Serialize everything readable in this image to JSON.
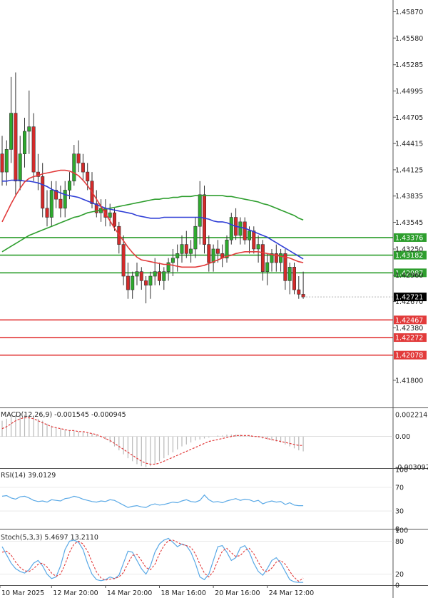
{
  "chart_data": [
    {
      "type": "candlestick",
      "panel": "price",
      "ylim": [
        1.415,
        1.46
      ],
      "yticks": [
        "1.45870",
        "1.45580",
        "1.45285",
        "1.44995",
        "1.44705",
        "1.44415",
        "1.44125",
        "1.43835",
        "1.43545",
        "1.43250",
        "1.42960",
        "1.42670",
        "1.42380",
        "1.41800"
      ],
      "xticks": [
        "10 Mar 2025",
        "12 Mar 20:00",
        "14 Mar 20:00",
        "18 Mar 16:00",
        "20 Mar 16:00",
        "24 Mar 12:00"
      ],
      "last_price": "1.42721",
      "support_resistance": [
        {
          "value": "1.43376",
          "color": "#2e9e2e"
        },
        {
          "value": "1.43182",
          "color": "#2e9e2e"
        },
        {
          "value": "1.42987",
          "color": "#2e9e2e"
        },
        {
          "value": "1.42467",
          "color": "#e23b3b"
        },
        {
          "value": "1.42272",
          "color": "#e23b3b"
        },
        {
          "value": "1.42078",
          "color": "#e23b3b"
        }
      ],
      "candles": [
        [
          1.443,
          1.445,
          1.4395,
          1.441
        ],
        [
          1.441,
          1.4445,
          1.4395,
          1.4435
        ],
        [
          1.4435,
          1.4515,
          1.442,
          1.4475
        ],
        [
          1.4475,
          1.452,
          1.4385,
          1.44
        ],
        [
          1.44,
          1.445,
          1.439,
          1.443
        ],
        [
          1.443,
          1.447,
          1.4415,
          1.4455
        ],
        [
          1.4455,
          1.45,
          1.443,
          1.446
        ],
        [
          1.446,
          1.4475,
          1.44,
          1.441
        ],
        [
          1.441,
          1.443,
          1.439,
          1.4405
        ],
        [
          1.4405,
          1.442,
          1.436,
          1.437
        ],
        [
          1.437,
          1.439,
          1.435,
          1.436
        ],
        [
          1.436,
          1.44,
          1.435,
          1.439
        ],
        [
          1.439,
          1.44,
          1.437,
          1.438
        ],
        [
          1.438,
          1.4395,
          1.436,
          1.437
        ],
        [
          1.437,
          1.44,
          1.436,
          1.439
        ],
        [
          1.439,
          1.441,
          1.438,
          1.44
        ],
        [
          1.44,
          1.444,
          1.4395,
          1.443
        ],
        [
          1.443,
          1.4445,
          1.441,
          1.442
        ],
        [
          1.442,
          1.443,
          1.44,
          1.441
        ],
        [
          1.441,
          1.442,
          1.439,
          1.44
        ],
        [
          1.44,
          1.441,
          1.437,
          1.4375
        ],
        [
          1.4375,
          1.439,
          1.436,
          1.4365
        ],
        [
          1.4365,
          1.438,
          1.4355,
          1.437
        ],
        [
          1.437,
          1.438,
          1.435,
          1.436
        ],
        [
          1.436,
          1.4375,
          1.435,
          1.4365
        ],
        [
          1.4365,
          1.437,
          1.4345,
          1.435
        ],
        [
          1.435,
          1.4355,
          1.432,
          1.433
        ],
        [
          1.433,
          1.434,
          1.4285,
          1.4295
        ],
        [
          1.4295,
          1.431,
          1.427,
          1.428
        ],
        [
          1.428,
          1.43,
          1.427,
          1.4295
        ],
        [
          1.4295,
          1.431,
          1.4285,
          1.43
        ],
        [
          1.43,
          1.4305,
          1.428,
          1.429
        ],
        [
          1.429,
          1.4295,
          1.4265,
          1.4285
        ],
        [
          1.4285,
          1.43,
          1.427,
          1.4295
        ],
        [
          1.4295,
          1.4315,
          1.4285,
          1.43
        ],
        [
          1.43,
          1.431,
          1.4285,
          1.429
        ],
        [
          1.429,
          1.4305,
          1.428,
          1.43
        ],
        [
          1.43,
          1.4315,
          1.429,
          1.431
        ],
        [
          1.431,
          1.4325,
          1.4295,
          1.4315
        ],
        [
          1.4315,
          1.433,
          1.43,
          1.432
        ],
        [
          1.432,
          1.434,
          1.431,
          1.433
        ],
        [
          1.433,
          1.4345,
          1.4315,
          1.432
        ],
        [
          1.432,
          1.4335,
          1.431,
          1.4325
        ],
        [
          1.4325,
          1.436,
          1.4315,
          1.435
        ],
        [
          1.435,
          1.44,
          1.433,
          1.4385
        ],
        [
          1.4385,
          1.4395,
          1.432,
          1.433
        ],
        [
          1.433,
          1.434,
          1.43,
          1.431
        ],
        [
          1.431,
          1.433,
          1.43,
          1.4325
        ],
        [
          1.4325,
          1.4335,
          1.431,
          1.432
        ],
        [
          1.432,
          1.433,
          1.4305,
          1.4315
        ],
        [
          1.4315,
          1.434,
          1.431,
          1.4335
        ],
        [
          1.4335,
          1.4365,
          1.433,
          1.436
        ],
        [
          1.436,
          1.437,
          1.4335,
          1.434
        ],
        [
          1.434,
          1.436,
          1.433,
          1.4355
        ],
        [
          1.4355,
          1.436,
          1.433,
          1.4335
        ],
        [
          1.4335,
          1.435,
          1.432,
          1.4345
        ],
        [
          1.4345,
          1.435,
          1.432,
          1.4325
        ],
        [
          1.4325,
          1.434,
          1.431,
          1.433
        ],
        [
          1.433,
          1.4335,
          1.429,
          1.43
        ],
        [
          1.43,
          1.432,
          1.4285,
          1.431
        ],
        [
          1.431,
          1.4325,
          1.43,
          1.432
        ],
        [
          1.432,
          1.433,
          1.43,
          1.431
        ],
        [
          1.431,
          1.4325,
          1.43,
          1.432
        ],
        [
          1.432,
          1.4325,
          1.428,
          1.429
        ],
        [
          1.429,
          1.431,
          1.4275,
          1.4305
        ],
        [
          1.4305,
          1.431,
          1.4275,
          1.428
        ],
        [
          1.428,
          1.4295,
          1.427,
          1.4275
        ],
        [
          1.4275,
          1.43,
          1.427,
          1.4272
        ]
      ],
      "ma_blue": [
        1.44,
        1.44,
        1.4401,
        1.4401,
        1.4401,
        1.44,
        1.44,
        1.4399,
        1.4398,
        1.4396,
        1.4394,
        1.4391,
        1.4389,
        1.4387,
        1.4385,
        1.4384,
        1.4383,
        1.4382,
        1.438,
        1.4378,
        1.4376,
        1.4374,
        1.4372,
        1.437,
        1.4369,
        1.4368,
        1.4367,
        1.4366,
        1.4365,
        1.4364,
        1.4362,
        1.4361,
        1.436,
        1.4359,
        1.4359,
        1.4359,
        1.436,
        1.436,
        1.436,
        1.436,
        1.436,
        1.436,
        1.436,
        1.436,
        1.436,
        1.4359,
        1.4358,
        1.4356,
        1.4355,
        1.4355,
        1.4354,
        1.4352,
        1.435,
        1.4349,
        1.4348,
        1.4346,
        1.4344,
        1.4342,
        1.434,
        1.4338,
        1.4335,
        1.4332,
        1.4329,
        1.4326,
        1.4323,
        1.432,
        1.4317,
        1.4314
      ],
      "ma_red": [
        1.4355,
        1.4365,
        1.4375,
        1.4384,
        1.4392,
        1.4399,
        1.4403,
        1.4405,
        1.4406,
        1.4408,
        1.4409,
        1.441,
        1.4411,
        1.4412,
        1.4412,
        1.4411,
        1.4409,
        1.4406,
        1.4401,
        1.4395,
        1.4388,
        1.438,
        1.4372,
        1.4364,
        1.4356,
        1.4348,
        1.4341,
        1.4334,
        1.4327,
        1.4321,
        1.4316,
        1.4313,
        1.4312,
        1.4311,
        1.431,
        1.4309,
        1.4308,
        1.4308,
        1.4307,
        1.4306,
        1.4305,
        1.4305,
        1.4305,
        1.4305,
        1.4306,
        1.4307,
        1.4309,
        1.4311,
        1.4313,
        1.4315,
        1.4317,
        1.4318,
        1.432,
        1.4321,
        1.4322,
        1.4322,
        1.4322,
        1.4322,
        1.4321,
        1.432,
        1.4319,
        1.4318,
        1.4317,
        1.4316,
        1.4315,
        1.4313,
        1.4311,
        1.431
      ],
      "ma_green": [
        1.4322,
        1.4325,
        1.4328,
        1.4331,
        1.4334,
        1.4337,
        1.434,
        1.4342,
        1.4344,
        1.4346,
        1.4348,
        1.435,
        1.4352,
        1.4354,
        1.4356,
        1.4358,
        1.436,
        1.4361,
        1.4363,
        1.4365,
        1.4366,
        1.4367,
        1.4368,
        1.4369,
        1.437,
        1.4371,
        1.4372,
        1.4373,
        1.4374,
        1.4375,
        1.4376,
        1.4377,
        1.4378,
        1.4379,
        1.438,
        1.438,
        1.4381,
        1.4381,
        1.4382,
        1.4382,
        1.4383,
        1.4383,
        1.4383,
        1.4384,
        1.4384,
        1.4384,
        1.4384,
        1.4384,
        1.4384,
        1.4384,
        1.4383,
        1.4383,
        1.4382,
        1.4381,
        1.438,
        1.4379,
        1.4378,
        1.4377,
        1.4375,
        1.4374,
        1.4372,
        1.437,
        1.4368,
        1.4366,
        1.4364,
        1.4362,
        1.4359,
        1.4357
      ]
    },
    {
      "type": "macd",
      "panel": "macd",
      "title": "MACD(12,26,9) -0.001545 -0.000945",
      "ylim": [
        -0.0032,
        0.0028
      ],
      "yticks": [
        "0.002214",
        "0.00",
        "-0.003097"
      ],
      "histogram": [
        0.0016,
        0.0018,
        0.002,
        0.0022,
        0.0023,
        0.0022,
        0.0021,
        0.002,
        0.0018,
        0.0016,
        0.0013,
        0.0011,
        0.0009,
        0.0008,
        0.0007,
        0.0006,
        0.0006,
        0.0005,
        0.0005,
        0.0004,
        0.0003,
        0.0002,
        0.0,
        -0.0003,
        -0.0006,
        -0.001,
        -0.0014,
        -0.0018,
        -0.0022,
        -0.0025,
        -0.0028,
        -0.003,
        -0.0031,
        -0.003,
        -0.0028,
        -0.0025,
        -0.0022,
        -0.0019,
        -0.0016,
        -0.0013,
        -0.001,
        -0.0008,
        -0.0006,
        -0.0004,
        -0.0003,
        -0.0002,
        -0.0001,
        0.0,
        0.0001,
        0.0001,
        0.0002,
        0.0002,
        0.0002,
        0.0002,
        0.0001,
        0.0001,
        0.0,
        -0.0001,
        -0.0002,
        -0.0003,
        -0.0004,
        -0.0005,
        -0.0006,
        -0.0008,
        -0.001,
        -0.0012,
        -0.0014,
        -0.0015
      ],
      "signal": [
        0.0008,
        0.001,
        0.0013,
        0.0016,
        0.0018,
        0.0019,
        0.0019,
        0.0018,
        0.0016,
        0.0014,
        0.0012,
        0.001,
        0.0009,
        0.0008,
        0.0007,
        0.0006,
        0.0006,
        0.0005,
        0.0005,
        0.0004,
        0.0003,
        0.0002,
        0.0,
        -0.0002,
        -0.0004,
        -0.0007,
        -0.001,
        -0.0013,
        -0.0016,
        -0.0019,
        -0.0022,
        -0.0025,
        -0.0027,
        -0.0028,
        -0.0028,
        -0.0027,
        -0.0025,
        -0.0023,
        -0.0021,
        -0.0019,
        -0.0017,
        -0.0015,
        -0.0013,
        -0.0011,
        -0.0009,
        -0.0007,
        -0.0005,
        -0.0004,
        -0.0003,
        -0.0002,
        -0.0001,
        0.0,
        0.0001,
        0.0001,
        0.0001,
        0.0001,
        0.0,
        0.0,
        -0.0001,
        -0.0002,
        -0.0003,
        -0.0004,
        -0.0005,
        -0.0006,
        -0.0007,
        -0.0008,
        -0.0009,
        -0.0009
      ]
    },
    {
      "type": "line",
      "panel": "rsi",
      "title": "RSI(14) 39.0129",
      "ylim": [
        0,
        100
      ],
      "yticks": [
        "100",
        "70",
        "30",
        "0"
      ],
      "values": [
        55,
        56,
        52,
        50,
        54,
        55,
        52,
        48,
        46,
        47,
        45,
        49,
        48,
        47,
        51,
        52,
        55,
        53,
        50,
        48,
        46,
        45,
        47,
        46,
        49,
        48,
        44,
        40,
        36,
        38,
        39,
        37,
        36,
        40,
        42,
        40,
        41,
        43,
        45,
        44,
        47,
        49,
        46,
        45,
        48,
        57,
        49,
        45,
        46,
        44,
        47,
        49,
        51,
        48,
        50,
        49,
        46,
        48,
        42,
        45,
        47,
        45,
        46,
        41,
        44,
        40,
        39,
        39
      ]
    },
    {
      "type": "line",
      "panel": "stoch",
      "title": "Stoch(5,3,3) 5.4697 13.2110",
      "ylim": [
        0,
        100
      ],
      "yticks": [
        "100",
        "80",
        "20",
        "0"
      ],
      "k": [
        70,
        55,
        40,
        30,
        25,
        22,
        28,
        40,
        45,
        35,
        20,
        12,
        15,
        35,
        65,
        80,
        82,
        78,
        65,
        40,
        20,
        10,
        8,
        10,
        15,
        12,
        18,
        40,
        62,
        60,
        45,
        30,
        20,
        35,
        60,
        75,
        82,
        85,
        78,
        70,
        75,
        72,
        60,
        40,
        15,
        10,
        20,
        45,
        70,
        72,
        60,
        45,
        50,
        68,
        72,
        60,
        40,
        25,
        18,
        30,
        45,
        50,
        40,
        25,
        10,
        6,
        5,
        5
      ],
      "d": [
        60,
        62,
        55,
        42,
        32,
        26,
        25,
        30,
        38,
        40,
        33,
        22,
        16,
        20,
        38,
        60,
        75,
        80,
        75,
        62,
        42,
        24,
        13,
        9,
        11,
        12,
        15,
        23,
        40,
        54,
        56,
        45,
        32,
        28,
        38,
        57,
        72,
        81,
        82,
        78,
        74,
        72,
        69,
        57,
        38,
        22,
        15,
        25,
        45,
        62,
        67,
        59,
        52,
        54,
        63,
        67,
        57,
        42,
        28,
        24,
        31,
        42,
        45,
        38,
        25,
        14,
        7,
        13
      ]
    }
  ]
}
